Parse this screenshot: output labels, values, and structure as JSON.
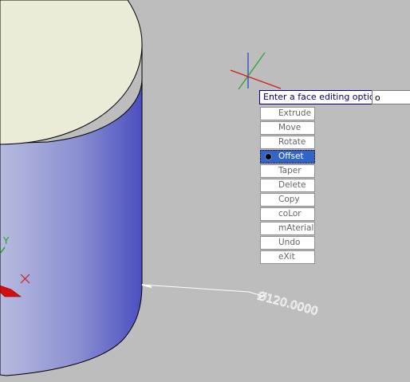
{
  "colors": {
    "background": "#bdbdbd",
    "cylinder_top": "#ecebd8",
    "cylinder_side_light": "#b7bbdf",
    "cylinder_side_dark": "#4a4fbf",
    "selection": "#3166c6"
  },
  "command_line": {
    "prompt": "Enter a face editing option",
    "input_value": "o"
  },
  "menu": {
    "items": [
      {
        "label": "Extrude"
      },
      {
        "label": "Move"
      },
      {
        "label": "Rotate"
      },
      {
        "label": "Offset",
        "selected": true
      },
      {
        "label": "Taper"
      },
      {
        "label": "Delete"
      },
      {
        "label": "Copy"
      },
      {
        "label": "coLor"
      },
      {
        "label": "mAterial"
      },
      {
        "label": "Undo"
      },
      {
        "label": "eXit"
      }
    ]
  },
  "dimension": {
    "text": "Ø120.0000"
  },
  "ucs_icon": {
    "y_label": "Y"
  }
}
